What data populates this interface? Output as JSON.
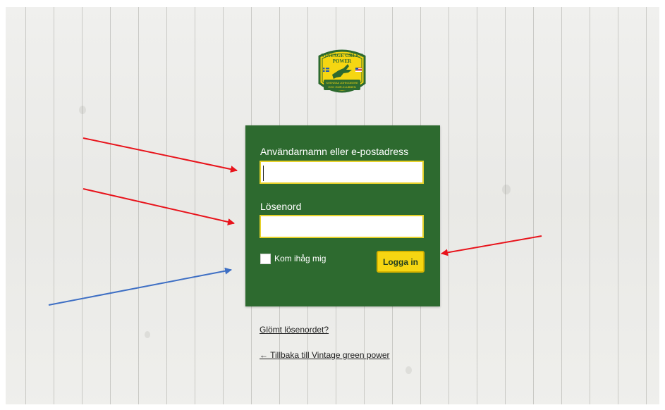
{
  "logo": {
    "line1": "VINTAGE GREEN",
    "line2": "POWER",
    "line3": "SVENSKA JOHN DEERE",
    "line4": "OCH GMR-KLUBBEN",
    "colors": {
      "green": "#2d6a2f",
      "yellow": "#f6d612"
    }
  },
  "login": {
    "username_label": "Användarnamn eller e-postadress",
    "username_value": "",
    "password_label": "Lösenord",
    "password_value": "",
    "remember_label": "Kom ihåg mig",
    "remember_checked": false,
    "submit_label": "Logga in"
  },
  "links": {
    "lost_password": "Glömt lösenordet?",
    "back_to_site": "← Tillbaka till Vintage green power"
  },
  "annotations": {
    "red": "#e8131b",
    "blue": "#3e6fc4"
  }
}
